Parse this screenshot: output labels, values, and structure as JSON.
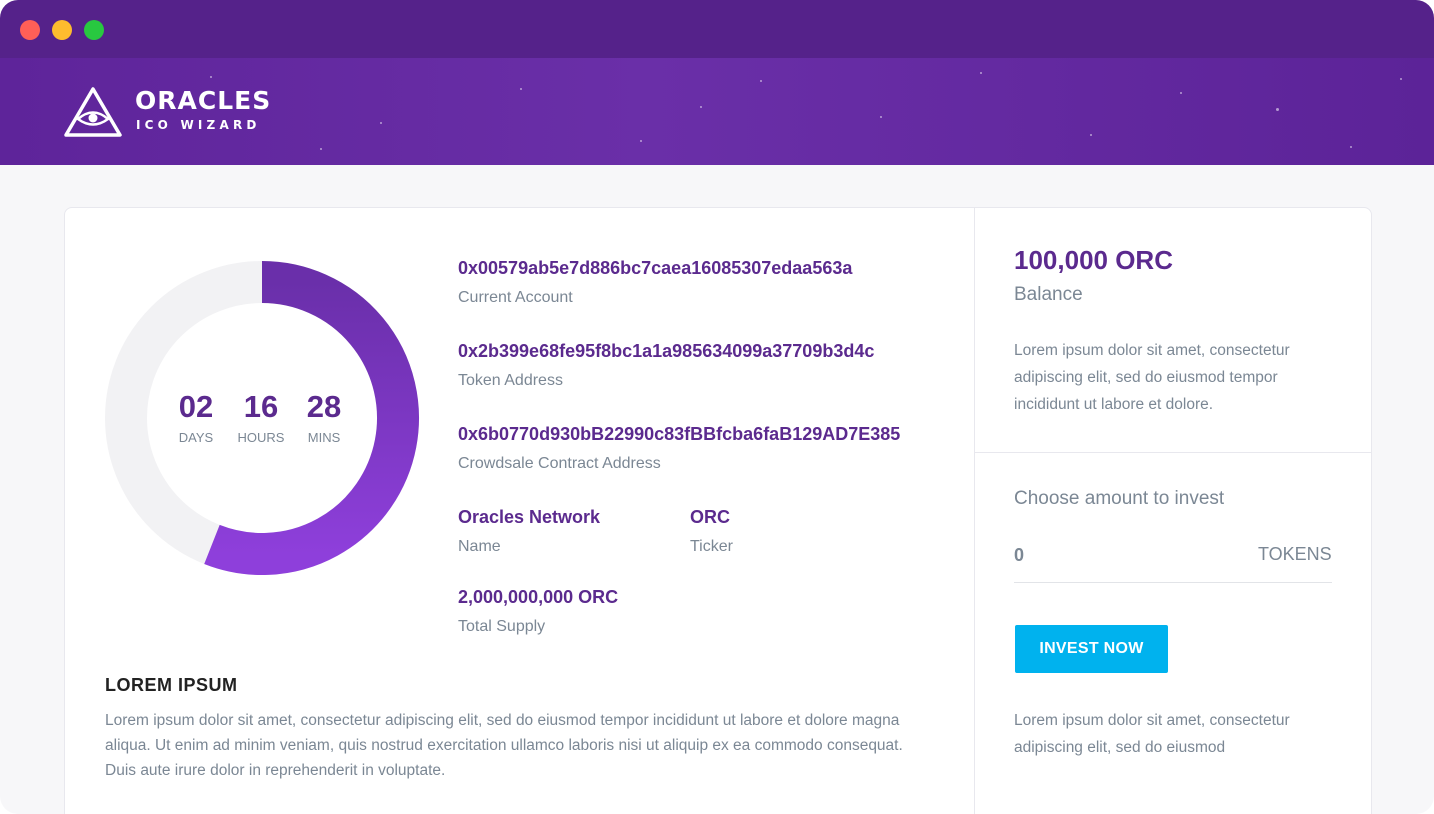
{
  "window": {
    "controls": [
      "close",
      "minimize",
      "maximize"
    ]
  },
  "header": {
    "logo_icon": "eye-triangle-icon",
    "title": "ORACLES",
    "subtitle": "ICO WIZARD"
  },
  "countdown": {
    "progress_fraction": 0.56,
    "days": "02",
    "days_label": "DAYS",
    "hours": "16",
    "hours_label": "HOURS",
    "mins": "28",
    "mins_label": "MINS"
  },
  "info": {
    "current_account": "0x00579ab5e7d886bc7caea16085307edaa563a",
    "current_account_label": "Current Account",
    "token_address": "0x2b399e68fe95f8bc1a1a985634099a37709b3d4c",
    "token_address_label": "Token Address",
    "crowdsale_address": "0x6b0770d930bB22990c83fBBfcba6faB129AD7E385",
    "crowdsale_address_label": "Crowdsale Contract Address",
    "name": "Oracles Network",
    "name_label": "Name",
    "ticker": "ORC",
    "ticker_label": "Ticker",
    "total_supply": "2,000,000,000 ORC",
    "total_supply_label": "Total Supply"
  },
  "description": {
    "title": "LOREM IPSUM",
    "body": "Lorem ipsum dolor sit amet, consectetur adipiscing elit, sed do eiusmod tempor incididunt ut labore et dolore magna aliqua. Ut enim ad minim veniam, quis nostrud exercitation ullamco laboris nisi ut aliquip ex ea commodo consequat. Duis aute irure dolor in reprehenderit in voluptate."
  },
  "sidebar": {
    "balance": "100,000 ORC",
    "balance_label": "Balance",
    "balance_text": "Lorem ipsum dolor sit amet, consectetur adipiscing elit, sed do eiusmod tempor incididunt ut labore et dolore.",
    "choose_label": "Choose amount to invest",
    "amount_value": "0",
    "tokens_label": "TOKENS",
    "invest_button": "INVEST NOW",
    "footer_text": "Lorem ipsum dolor sit amet, consectetur adipiscing elit, sed do eiusmod"
  },
  "colors": {
    "brand_purple": "#5b2a8e",
    "header_purple": "#55228a",
    "donut_purple": "#7b35c4",
    "button_blue": "#00b2ee",
    "muted_text": "#7b8794"
  }
}
